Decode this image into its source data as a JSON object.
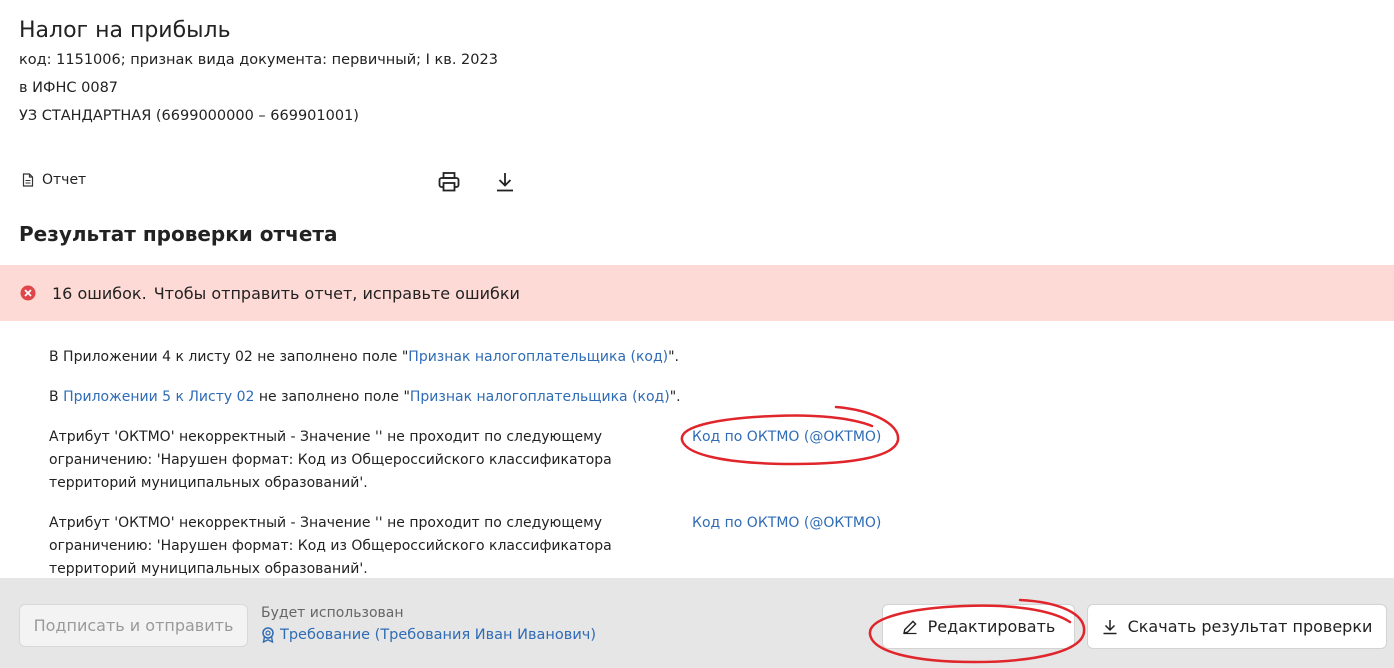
{
  "header": {
    "title": "Налог на прибыль",
    "line1": "код: 1151006; признак вида документа: первичный; I кв. 2023",
    "line2": "в ИФНС 0087",
    "line3": "УЗ СТАНДАРТНАЯ (6699000000 – 669901001)"
  },
  "report": {
    "label": "Отчет",
    "icons": [
      "document-icon",
      "print-icon",
      "download-icon"
    ]
  },
  "section_title": "Результат проверки отчета",
  "banner": {
    "count": "16 ошибок.",
    "message": "Чтобы отправить отчет, исправьте ошибки",
    "color": "#fddad6",
    "icon_color": "#e0454a"
  },
  "errors": {
    "e1": {
      "prefix": "В Приложении 4 к листу 02 не заполнено поле \"",
      "link": "Признак налогоплательщика (код)",
      "suffix": "\"."
    },
    "e2": {
      "pre": "В ",
      "link1": "Приложении 5 к Листу 02",
      "mid": " не заполнено поле \"",
      "link2": "Признак налогоплательщика (код)",
      "suffix": "\"."
    },
    "e3": {
      "text": "Атрибут 'ОКТМО' некорректный - Значение '' не проходит по следующему ограничению: 'Нарушен формат: Код из Общероссийского классификатора территорий муниципальных образований'.",
      "link": "Код по ОКТМО (@ОКТМО)"
    },
    "e4": {
      "text": "Атрибут 'ОКТМО' некорректный - Значение '' не проходит по следующему ограничению: 'Нарушен формат: Код из Общероссийского классификатора территорий муниципальных образований'.",
      "link": "Код по ОКТМО (@ОКТМО)"
    }
  },
  "footer": {
    "sign_label": "Подписать и отправить",
    "will_use_label": "Будет использован",
    "requirement_link": "Требование (Требования Иван Иванович)",
    "edit_label": "Редактировать",
    "download_label": "Скачать результат проверки"
  },
  "colors": {
    "link": "#2f6cb5",
    "annotation": "#e0252b",
    "footer_bg": "#e6e6e6"
  }
}
